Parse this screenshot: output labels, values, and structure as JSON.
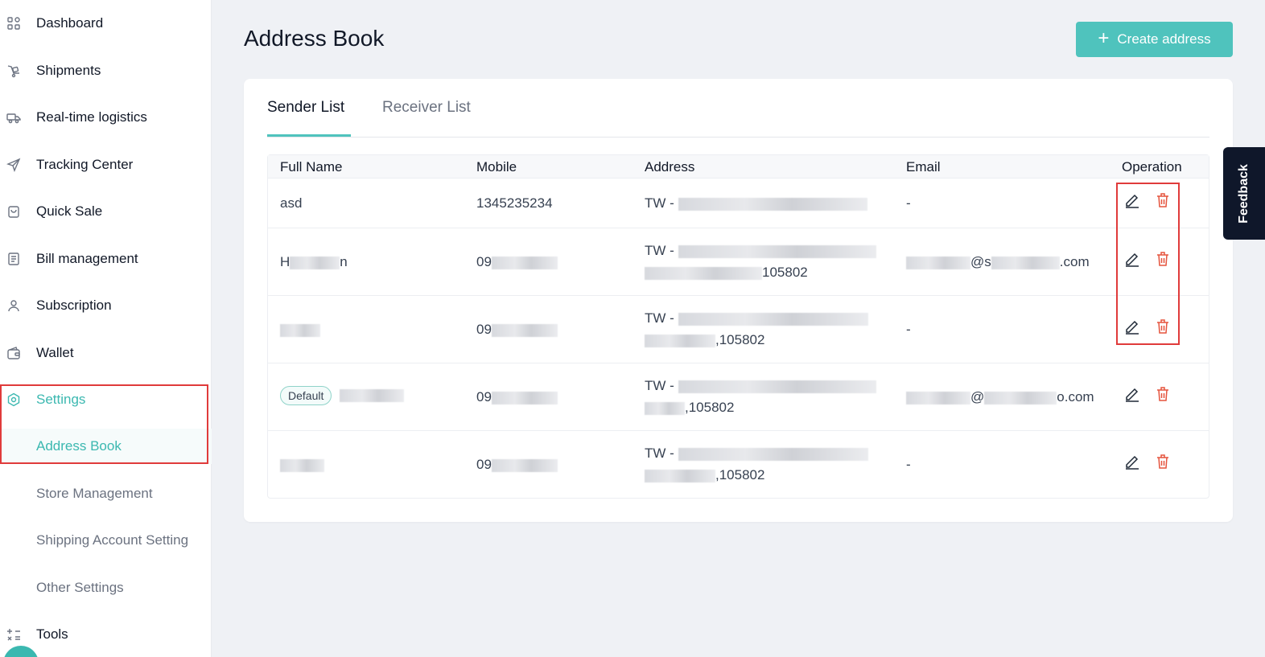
{
  "sidebar": {
    "items": [
      {
        "label": "Dashboard",
        "icon": "dashboard-icon"
      },
      {
        "label": "Shipments",
        "icon": "shipments-icon"
      },
      {
        "label": "Real-time logistics",
        "icon": "truck-icon"
      },
      {
        "label": "Tracking Center",
        "icon": "send-icon"
      },
      {
        "label": "Quick Sale",
        "icon": "bag-icon"
      },
      {
        "label": "Bill management",
        "icon": "bill-icon"
      },
      {
        "label": "Subscription",
        "icon": "user-icon"
      },
      {
        "label": "Wallet",
        "icon": "wallet-icon"
      },
      {
        "label": "Settings",
        "icon": "settings-icon"
      },
      {
        "label": "Address Book"
      },
      {
        "label": "Store Management"
      },
      {
        "label": "Shipping Account Setting"
      },
      {
        "label": "Other Settings"
      },
      {
        "label": "Tools",
        "icon": "tools-icon"
      }
    ],
    "active_section": "Settings",
    "selected_item": "Address Book"
  },
  "header": {
    "title": "Address Book",
    "create_button_label": "Create address"
  },
  "tabs": [
    {
      "label": "Sender List",
      "active": true
    },
    {
      "label": "Receiver List",
      "active": false
    }
  ],
  "table": {
    "columns": [
      "Full Name",
      "Mobile",
      "Address",
      "Email",
      "Operation"
    ],
    "rows": [
      {
        "name": "asd",
        "mobile": "1345235234",
        "address_prefix": "TW - ",
        "address_suffix": "",
        "email": "-",
        "default": false
      },
      {
        "name_prefix": "H",
        "name_suffix": "n",
        "mobile": "09",
        "address_prefix": "TW - ",
        "address_suffix": "105802",
        "email_prefix": "",
        "email_mid": "@s",
        "email_suffix": ".com",
        "default": false
      },
      {
        "name_prefix": "",
        "name_suffix": "",
        "mobile": "09",
        "address_prefix": "TW - ",
        "address_suffix": ",105802",
        "email": "-",
        "default": false
      },
      {
        "name_prefix": "",
        "name_suffix": "",
        "mobile": "09",
        "address_prefix": "TW - ",
        "address_suffix": ",105802",
        "email_mid": "@",
        "email_suffix": "o.com",
        "default": true,
        "default_label": "Default"
      },
      {
        "name_prefix": "",
        "name_suffix": "",
        "mobile": "09",
        "address_prefix": "TW - ",
        "address_suffix": ",105802",
        "email": "-",
        "default": false
      }
    ]
  },
  "feedback_label": "Feedback",
  "colors": {
    "accent": "#4fc3bd",
    "delete": "#e5533d",
    "highlight_box": "#e03b3b"
  }
}
